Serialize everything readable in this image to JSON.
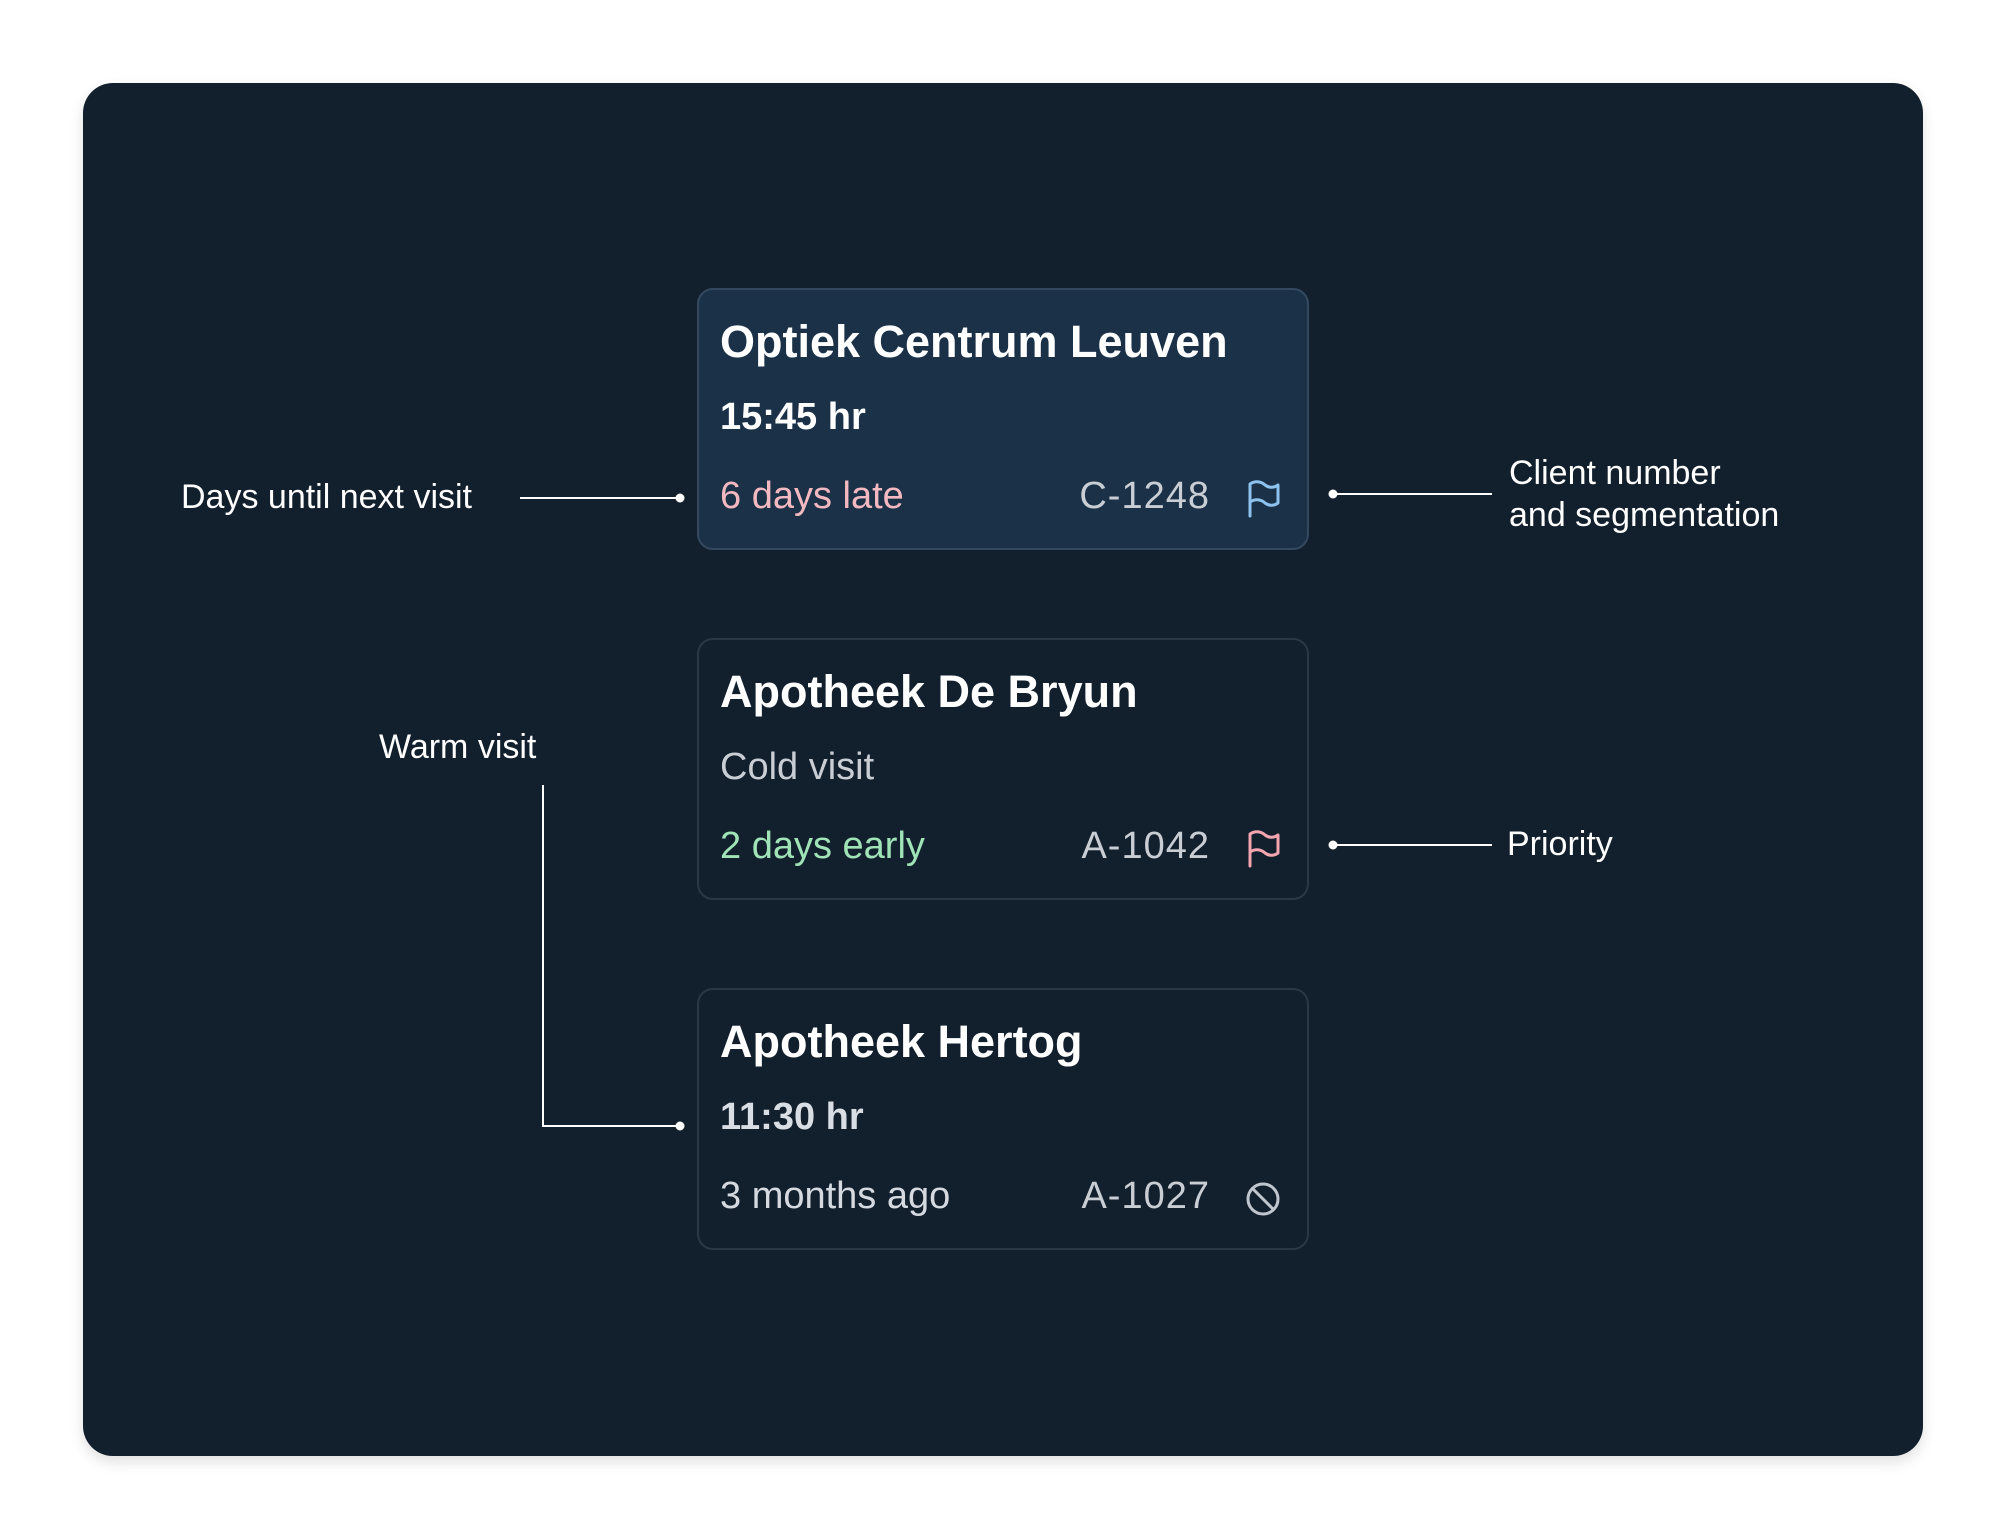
{
  "cards": [
    {
      "name": "Optiek Centrum Leuven",
      "time": "15:45 hr",
      "status": "6 days late",
      "client_number": "C-1248",
      "icon": "flag-icon",
      "active": true,
      "status_color": "#f4b9c0",
      "icon_color": "#8ec3f0"
    },
    {
      "name": "Apotheek De Bryun",
      "visit_type": "Cold visit",
      "status": "2 days early",
      "client_number": "A-1042",
      "icon": "flag-icon",
      "status_color": "#9fe3b6",
      "icon_color": "#f4a6b0"
    },
    {
      "name": "Apotheek Hertog",
      "time": "11:30 hr",
      "status": "3 months ago",
      "client_number": "A-1027",
      "icon": "block-icon",
      "status_color": "#d5dae0",
      "icon_color": "#c0c6cd"
    }
  ],
  "annotations": {
    "days_until_next_visit": "Days until next visit",
    "client_number_line1": "Client number",
    "client_number_line2": "and segmentation",
    "warm_visit": "Warm visit",
    "priority": "Priority"
  },
  "colors": {
    "panel_background": "#121f2d",
    "active_card_background": "#1a3148",
    "card_border": "#2a3747"
  }
}
